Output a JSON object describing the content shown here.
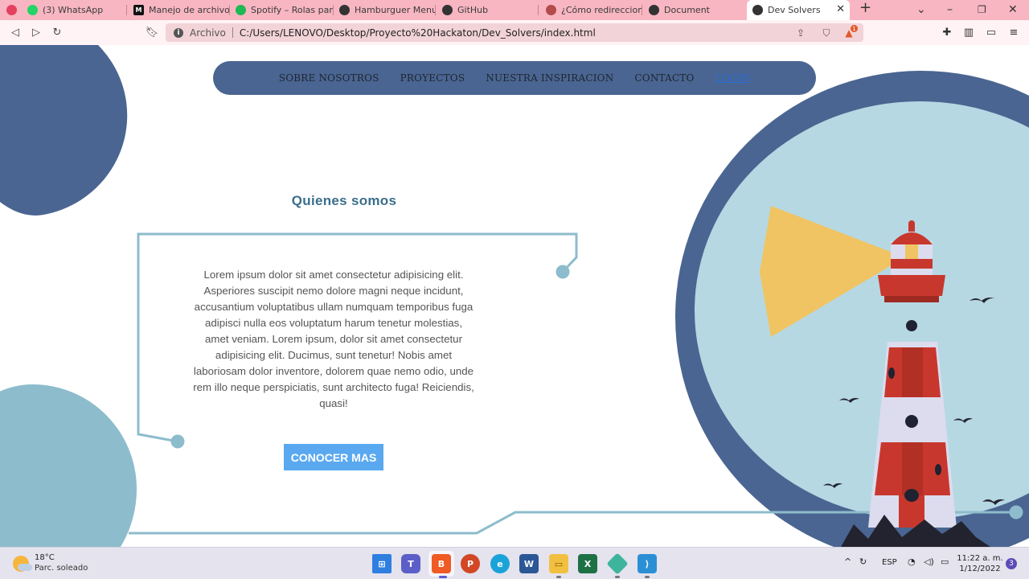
{
  "browser": {
    "tabs": [
      {
        "label": "",
        "icon": "figma-icon",
        "color": "#e4405f"
      },
      {
        "label": "(3) WhatsApp",
        "icon": "whatsapp-icon",
        "color": "#25d366"
      },
      {
        "label": "Manejo de archivos",
        "icon": "medium-icon",
        "color": "#111111"
      },
      {
        "label": "Spotify – Rolas para la",
        "icon": "spotify-icon",
        "color": "#1db954"
      },
      {
        "label": "Hamburguer Menu",
        "icon": "globe-icon",
        "color": "#333333"
      },
      {
        "label": "GitHub",
        "icon": "github-icon",
        "color": "#333333"
      },
      {
        "label": "¿Cómo redireccionar",
        "icon": "sitepoint-icon",
        "color": "#b44a4a"
      },
      {
        "label": "Document",
        "icon": "globe-icon",
        "color": "#333333"
      },
      {
        "label": "Dev Solvers",
        "icon": "globe-icon",
        "color": "#333333"
      }
    ],
    "new_tab": "+",
    "address": {
      "scheme": "Archivo",
      "url": "C:/Users/LENOVO/Desktop/Proyecto%20Hackaton/Dev_Solvers/index.html"
    },
    "brave_badge": "1"
  },
  "page": {
    "nav": [
      "SOBRE NOSOTROS",
      "PROYECTOS",
      "NUESTRA INSPIRACION",
      "CONTACTO"
    ],
    "login": "LOGIN",
    "title": "Quienes somos",
    "body": "Lorem ipsum dolor sit amet consectetur adipisicing elit. Asperiores suscipit nemo dolore magni neque incidunt, accusantium voluptatibus ullam numquam temporibus fuga adipisci nulla eos voluptatum harum tenetur molestias, amet veniam. Lorem ipsum, dolor sit amet consectetur adipisicing elit. Ducimus, sunt tenetur! Nobis amet laboriosam dolor inventore, dolorem quae nemo odio, unde rem illo neque perspiciatis, sunt architecto fuga! Reiciendis, quasi!",
    "cta": "CONOCER MAS",
    "colors": {
      "navy": "#4a6591",
      "light_blue": "#b6d8e3",
      "teal": "#8dbccc",
      "button": "#5aa9f0",
      "lighthouse_red": "#c8372d",
      "light_beam": "#f0c462"
    }
  },
  "taskbar": {
    "weather_temp": "18°C",
    "weather_desc": "Parc. soleado",
    "apps": [
      "start-icon",
      "teams-icon",
      "brave-icon",
      "powerpoint-icon",
      "edge-icon",
      "word-icon",
      "file-explorer-icon",
      "excel-icon",
      "gitkraken-icon",
      "vscode-icon"
    ],
    "language": "ESP",
    "time": "11:22 a. m.",
    "date": "1/12/2022",
    "notifications": "3"
  }
}
